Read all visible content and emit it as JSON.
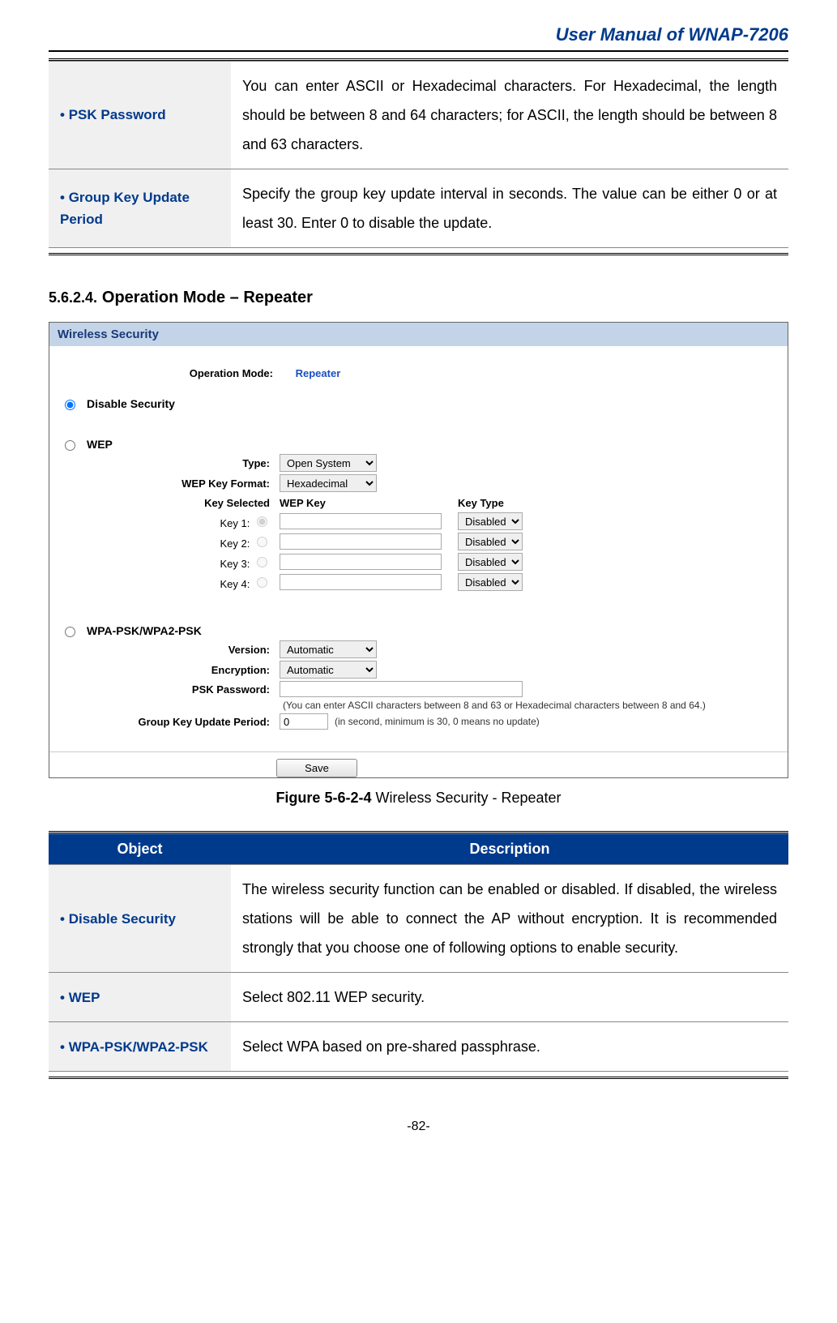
{
  "header": {
    "manual_title": "User Manual of WNAP-7206"
  },
  "table1": {
    "rows": [
      {
        "object": "PSK Password",
        "description": "You can enter ASCII or Hexadecimal characters. For Hexadecimal, the length should be between 8 and 64 characters; for ASCII, the length should be between 8 and 63 characters."
      },
      {
        "object": "Group Key Update Period",
        "description": "Specify the group key update interval in seconds. The value can be either 0 or at least 30. Enter 0 to disable the update."
      }
    ]
  },
  "section": {
    "number": "5.6.2.4.",
    "title": "Operation Mode – Repeater"
  },
  "screenshot": {
    "panel_title": "Wireless Security",
    "op_mode_label": "Operation Mode:",
    "op_mode_value": "Repeater",
    "disable_security_label": "Disable Security",
    "wep": {
      "label": "WEP",
      "type_label": "Type:",
      "type_value": "Open System",
      "format_label": "WEP Key Format:",
      "format_value": "Hexadecimal",
      "header_selected": "Key Selected",
      "header_wepkey": "WEP Key",
      "header_keytype": "Key Type",
      "keys": [
        {
          "label": "Key 1:",
          "type": "Disabled"
        },
        {
          "label": "Key 2:",
          "type": "Disabled"
        },
        {
          "label": "Key 3:",
          "type": "Disabled"
        },
        {
          "label": "Key 4:",
          "type": "Disabled"
        }
      ]
    },
    "wpa": {
      "label": "WPA-PSK/WPA2-PSK",
      "version_label": "Version:",
      "version_value": "Automatic",
      "encryption_label": "Encryption:",
      "encryption_value": "Automatic",
      "psk_label": "PSK Password:",
      "psk_hint": "(You can enter ASCII characters between 8 and 63 or Hexadecimal characters between 8 and 64.)",
      "period_label": "Group Key Update Period:",
      "period_value": "0",
      "period_hint": "(in second, minimum is 30, 0 means no update)"
    },
    "save_label": "Save"
  },
  "figure_caption": {
    "bold": "Figure 5-6-2-4",
    "rest": " Wireless Security - Repeater"
  },
  "table2": {
    "object_header": "Object",
    "description_header": "Description",
    "rows": [
      {
        "object": "Disable Security",
        "description": "The wireless security function can be enabled or disabled. If disabled, the wireless stations will be able to connect the AP without encryption. It is recommended strongly that you choose one of following options to enable security."
      },
      {
        "object": "WEP",
        "description": "Select 802.11 WEP security."
      },
      {
        "object": "WPA-PSK/WPA2-PSK",
        "description": "Select WPA based on pre-shared passphrase."
      }
    ]
  },
  "page_number": "-82-"
}
